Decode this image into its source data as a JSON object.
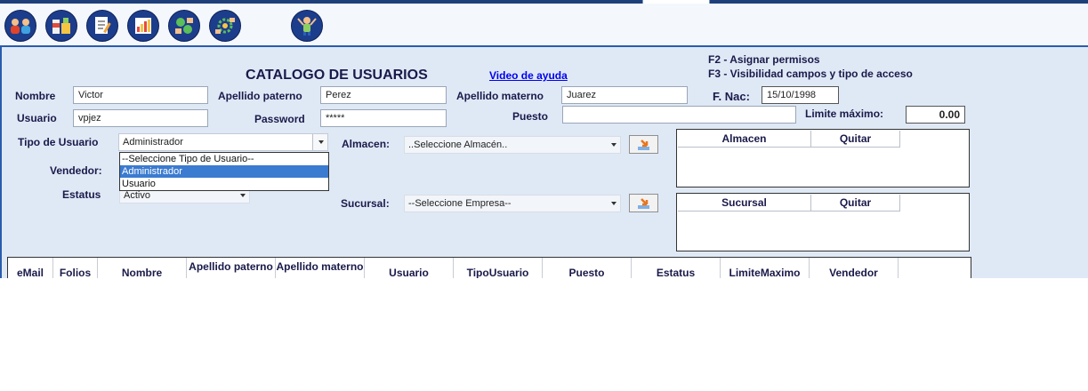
{
  "colors": {
    "top_bar": "#1f3f7a",
    "panel_bg": "#dfe9f6",
    "panel_border": "#2a5cad",
    "icon_bg": "#1c3d8c",
    "selected_option": "#3b7bd0",
    "link": "#0000ee"
  },
  "toolbar": {
    "icons": [
      "users-icon",
      "products-icon",
      "document-edit-icon",
      "bar-chart-icon",
      "money-exchange-icon",
      "settings-money-icon",
      "person-celebrate-icon"
    ]
  },
  "shortcuts": {
    "f2": "F2 - Asignar permisos",
    "f3": "F3 - Visibilidad campos y tipo de acceso"
  },
  "page": {
    "title": "CATALOGO DE USUARIOS",
    "help_link": "Video de ayuda"
  },
  "form": {
    "nombre_label": "Nombre",
    "nombre_value": "Victor",
    "ap_paterno_label": "Apellido paterno",
    "ap_paterno_value": "Perez",
    "ap_materno_label": "Apellido materno",
    "ap_materno_value": "Juarez",
    "fnac_label": "F. Nac:",
    "fnac_value": "15/10/1998",
    "usuario_label": "Usuario",
    "usuario_value": "vpjez",
    "password_label": "Password",
    "password_value": "*****",
    "puesto_label": "Puesto",
    "puesto_value": "",
    "limite_label": "Limite máximo:",
    "limite_value": "0.00",
    "tipo_label": "Tipo de Usuario",
    "tipo_value": "Administrador",
    "tipo_options": [
      "--Seleccione Tipo de Usuario--",
      "Administrador",
      "Usuario"
    ],
    "vendedor_label": "Vendedor:",
    "estatus_label": "Estatus",
    "estatus_value": "Activo",
    "almacen_label": "Almacen:",
    "almacen_value": "..Seleccione Almacén..",
    "sucursal_label": "Sucursal:",
    "sucursal_value": "--Seleccione Empresa--"
  },
  "almacen_table": {
    "col1": "Almacen",
    "col2": "Quitar"
  },
  "sucursal_table": {
    "col1": "Sucursal",
    "col2": "Quitar"
  },
  "grid": {
    "columns": [
      "eMail",
      "Folios",
      "Nombre",
      "Apellido paterno",
      "Apellido materno",
      "Usuario",
      "TipoUsuario",
      "Puesto",
      "Estatus",
      "LimiteMaximo",
      "Vendedor"
    ]
  }
}
